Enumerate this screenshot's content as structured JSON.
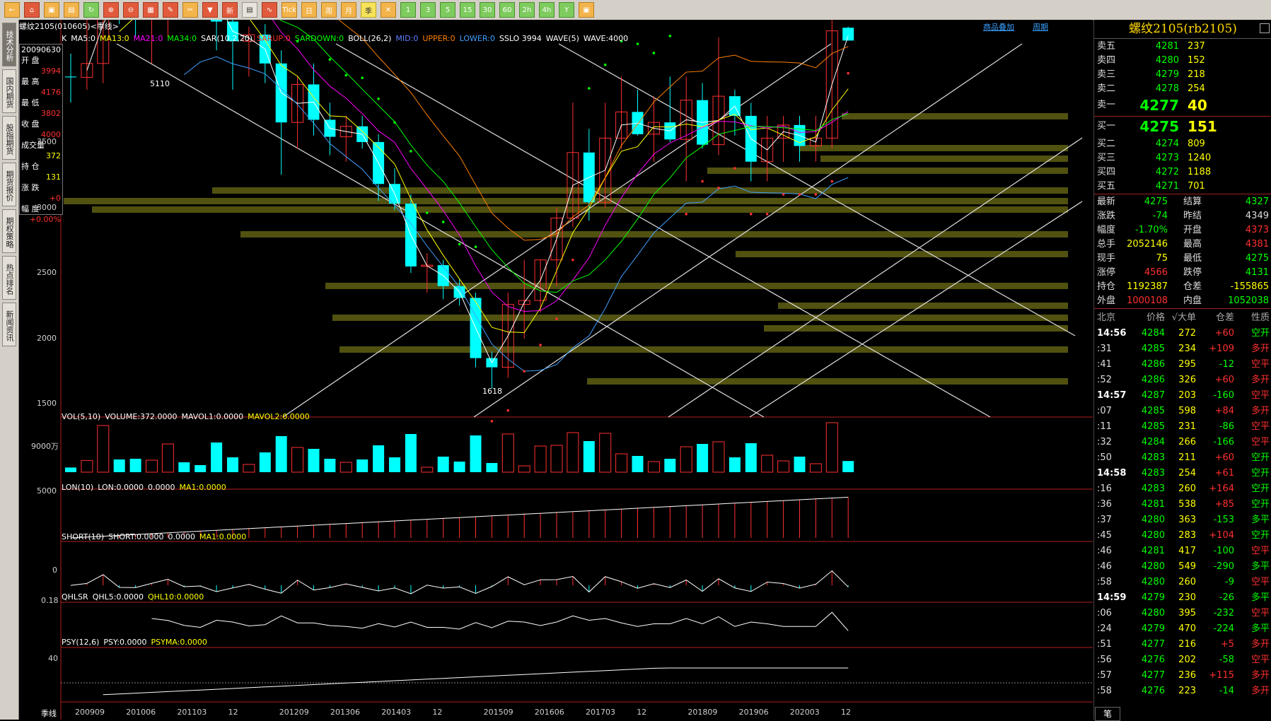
{
  "toolbar": {
    "buttons": [
      "←",
      "⌂",
      "▣",
      "▤",
      "↻",
      "⊕",
      "⊖",
      "▦",
      "✎",
      "✂",
      "▼",
      "新",
      "▤",
      "∿",
      "Tick",
      "日",
      "周",
      "月",
      "季",
      "✕",
      "1",
      "3",
      "5",
      "15",
      "30",
      "60",
      "2h",
      "4h",
      "Y",
      "▣"
    ]
  },
  "left_tabs": [
    "技术分析",
    "国内期货",
    "股指期货",
    "期货报价",
    "期权策略",
    "热点排名",
    "新闻资讯"
  ],
  "subtitle": "螺纹2105(010605)<季线>",
  "links": {
    "overlay": "商品叠加",
    "period": "周期"
  },
  "main_indicators": [
    {
      "t": "K",
      "c": "#ffffff"
    },
    {
      "t": "MA5:0",
      "c": "#ffffff"
    },
    {
      "t": "MA13:0",
      "c": "#ffff00"
    },
    {
      "t": "MA21:0",
      "c": "#ff00ff"
    },
    {
      "t": "MA34:0",
      "c": "#00ff00"
    },
    {
      "t": "SAR(10,2,20)",
      "c": "#ffffff"
    },
    {
      "t": "SARUP:0",
      "c": "#ff3030"
    },
    {
      "t": "SARDOWN:0",
      "c": "#00ff00"
    },
    {
      "t": "BOLL(26,2)",
      "c": "#ffffff"
    },
    {
      "t": "MID:0",
      "c": "#6080ff"
    },
    {
      "t": "UPPER:0",
      "c": "#ff8000"
    },
    {
      "t": "LOWER:0",
      "c": "#40a0ff"
    },
    {
      "t": "SSLO 3994",
      "c": "#ffffff"
    },
    {
      "t": "WAVE(5)",
      "c": "#ffffff"
    },
    {
      "t": "WAVE:4000",
      "c": "#ffffff"
    }
  ],
  "infobox": {
    "date": "20090630",
    "rows": [
      {
        "label": "开 盘",
        "value": "3994",
        "color": "#ff3030"
      },
      {
        "label": "最 高",
        "value": "4176",
        "color": "#ff3030"
      },
      {
        "label": "最 低",
        "value": "3802",
        "color": "#ff3030"
      },
      {
        "label": "收 盘",
        "value": "4000",
        "color": "#ff3030"
      },
      {
        "label": "成交量",
        "value": "372",
        "color": "#ffff00"
      },
      {
        "label": "持 仓",
        "value": "131",
        "color": "#ffff00"
      },
      {
        "label": "涨 跌",
        "value": "+0",
        "color": "#ff3030"
      },
      {
        "label": "幅 度",
        "value": "+0.00%",
        "color": "#ff3030"
      }
    ]
  },
  "price_axis": [
    "3500",
    "3000",
    "2500",
    "2000",
    "1500"
  ],
  "annotations": {
    "high": "5110",
    "low": "1618"
  },
  "vol_panel": {
    "title_parts": [
      {
        "t": "VOL(5,10)",
        "c": "#ffffff"
      },
      {
        "t": "VOLUME:372.0000",
        "c": "#ffffff"
      },
      {
        "t": "MAVOL1:0.0000",
        "c": "#ffffff"
      },
      {
        "t": "MAVOL2:0.0000",
        "c": "#ffff00"
      }
    ],
    "axis": "9000万"
  },
  "lon_panel": {
    "title_parts": [
      {
        "t": "LON(10)",
        "c": "#ffffff"
      },
      {
        "t": "LON:0.0000",
        "c": "#ffffff"
      },
      {
        "t": "0.0000",
        "c": "#ffffff"
      },
      {
        "t": "MA1:0.0000",
        "c": "#ffff00"
      }
    ],
    "axis": "5000"
  },
  "short_panel": {
    "title_parts": [
      {
        "t": "SHORT(10)",
        "c": "#ffffff"
      },
      {
        "t": "SHORT:0.0000",
        "c": "#ffffff"
      },
      {
        "t": "0.0000",
        "c": "#ffffff"
      },
      {
        "t": "MA1:0.0000",
        "c": "#ffff00"
      }
    ],
    "axis": "0"
  },
  "qhlsr_panel": {
    "title_parts": [
      {
        "t": "QHLSR",
        "c": "#ffffff"
      },
      {
        "t": "QHL5:0.0000",
        "c": "#ffffff"
      },
      {
        "t": "QHL10:0.0000",
        "c": "#ffff00"
      }
    ],
    "axis": "0.18"
  },
  "psy_panel": {
    "title_parts": [
      {
        "t": "PSY(12,6)",
        "c": "#ffffff"
      },
      {
        "t": "PSY:0.0000",
        "c": "#ffffff"
      },
      {
        "t": "PSYMA:0.0000",
        "c": "#ffff00"
      }
    ],
    "axis": "40"
  },
  "x_axis": {
    "period": "季线",
    "labels": [
      "200909",
      "201006",
      "201103",
      "12",
      "201209",
      "201306",
      "201403",
      "12",
      "201509",
      "201606",
      "201703",
      "12",
      "201809",
      "201906",
      "202003",
      "12"
    ]
  },
  "quote": {
    "title": "螺纹2105(rb2105)",
    "asks": [
      {
        "name": "卖五",
        "price": "4281",
        "vol": "237"
      },
      {
        "name": "卖四",
        "price": "4280",
        "vol": "152"
      },
      {
        "name": "卖三",
        "price": "4279",
        "vol": "218"
      },
      {
        "name": "卖二",
        "price": "4278",
        "vol": "254"
      },
      {
        "name": "卖一",
        "price": "4277",
        "vol": "40"
      }
    ],
    "bids": [
      {
        "name": "买一",
        "price": "4275",
        "vol": "151"
      },
      {
        "name": "买二",
        "price": "4274",
        "vol": "809"
      },
      {
        "name": "买三",
        "price": "4273",
        "vol": "1240"
      },
      {
        "name": "买四",
        "price": "4272",
        "vol": "1188"
      },
      {
        "name": "买五",
        "price": "4271",
        "vol": "701"
      }
    ],
    "stats": [
      {
        "l1": "最新",
        "v1": "4275",
        "c1": "#00ff00",
        "l2": "结算",
        "v2": "4327",
        "c2": "#00ff00"
      },
      {
        "l1": "涨跌",
        "v1": "-74",
        "c1": "#00ff00",
        "l2": "昨结",
        "v2": "4349",
        "c2": "#dddddd"
      },
      {
        "l1": "幅度",
        "v1": "-1.70%",
        "c1": "#00ff00",
        "l2": "开盘",
        "v2": "4373",
        "c2": "#ff3030"
      },
      {
        "l1": "总手",
        "v1": "2052146",
        "c1": "#ffff00",
        "l2": "最高",
        "v2": "4381",
        "c2": "#ff3030"
      },
      {
        "l1": "现手",
        "v1": "75",
        "c1": "#ffff00",
        "l2": "最低",
        "v2": "4275",
        "c2": "#00ff00"
      },
      {
        "l1": "涨停",
        "v1": "4566",
        "c1": "#ff3030",
        "l2": "跌停",
        "v2": "4131",
        "c2": "#00ff00"
      },
      {
        "l1": "持仓",
        "v1": "1192387",
        "c1": "#ffff00",
        "l2": "仓差",
        "v2": "-155865",
        "c2": "#ffff00"
      },
      {
        "l1": "外盘",
        "v1": "1000108",
        "c1": "#ff3030",
        "l2": "内盘",
        "v2": "1052038",
        "c2": "#00ff00"
      }
    ],
    "tick_header": [
      "北京",
      "价格",
      "√大单",
      "仓差",
      "性质"
    ],
    "ticks": [
      {
        "t": "14:56",
        "b": true,
        "p": "4284",
        "v": "272",
        "c": "+60",
        "cc": "#ff3030",
        "k": "空开",
        "kc": "#00ff00"
      },
      {
        "t": ":31",
        "b": false,
        "p": "4285",
        "v": "234",
        "c": "+109",
        "cc": "#ff3030",
        "k": "多开",
        "kc": "#ff3030"
      },
      {
        "t": ":41",
        "b": false,
        "p": "4286",
        "v": "295",
        "c": "-12",
        "cc": "#00ff00",
        "k": "空平",
        "kc": "#ff3030"
      },
      {
        "t": ":52",
        "b": false,
        "p": "4286",
        "v": "326",
        "c": "+60",
        "cc": "#ff3030",
        "k": "多开",
        "kc": "#ff3030"
      },
      {
        "t": "14:57",
        "b": true,
        "p": "4287",
        "v": "203",
        "c": "-160",
        "cc": "#00ff00",
        "k": "空平",
        "kc": "#ff3030"
      },
      {
        "t": ":07",
        "b": false,
        "p": "4285",
        "v": "598",
        "c": "+84",
        "cc": "#ff3030",
        "k": "多开",
        "kc": "#ff3030"
      },
      {
        "t": ":11",
        "b": false,
        "p": "4285",
        "v": "231",
        "c": "-86",
        "cc": "#00ff00",
        "k": "空平",
        "kc": "#ff3030"
      },
      {
        "t": ":32",
        "b": false,
        "p": "4284",
        "v": "266",
        "c": "-166",
        "cc": "#00ff00",
        "k": "空平",
        "kc": "#ff3030"
      },
      {
        "t": ":50",
        "b": false,
        "p": "4283",
        "v": "211",
        "c": "+60",
        "cc": "#ff3030",
        "k": "空开",
        "kc": "#00ff00"
      },
      {
        "t": "14:58",
        "b": true,
        "p": "4283",
        "v": "254",
        "c": "+61",
        "cc": "#ff3030",
        "k": "空开",
        "kc": "#00ff00"
      },
      {
        "t": ":16",
        "b": false,
        "p": "4283",
        "v": "260",
        "c": "+164",
        "cc": "#ff3030",
        "k": "空开",
        "kc": "#00ff00"
      },
      {
        "t": ":36",
        "b": false,
        "p": "4281",
        "v": "538",
        "c": "+85",
        "cc": "#ff3030",
        "k": "空开",
        "kc": "#00ff00"
      },
      {
        "t": ":37",
        "b": false,
        "p": "4280",
        "v": "363",
        "c": "-153",
        "cc": "#00ff00",
        "k": "多平",
        "kc": "#00ff00"
      },
      {
        "t": ":45",
        "b": false,
        "p": "4280",
        "v": "283",
        "c": "+104",
        "cc": "#ff3030",
        "k": "空开",
        "kc": "#00ff00"
      },
      {
        "t": ":46",
        "b": false,
        "p": "4281",
        "v": "417",
        "c": "-100",
        "cc": "#00ff00",
        "k": "空平",
        "kc": "#ff3030"
      },
      {
        "t": ":46",
        "b": false,
        "p": "4280",
        "v": "549",
        "c": "-290",
        "cc": "#00ff00",
        "k": "多平",
        "kc": "#00ff00"
      },
      {
        "t": ":58",
        "b": false,
        "p": "4280",
        "v": "260",
        "c": "-9",
        "cc": "#00ff00",
        "k": "空平",
        "kc": "#ff3030"
      },
      {
        "t": "14:59",
        "b": true,
        "p": "4279",
        "v": "230",
        "c": "-26",
        "cc": "#00ff00",
        "k": "多平",
        "kc": "#00ff00"
      },
      {
        "t": ":06",
        "b": false,
        "p": "4280",
        "v": "395",
        "c": "-232",
        "cc": "#00ff00",
        "k": "空平",
        "kc": "#ff3030"
      },
      {
        "t": ":24",
        "b": false,
        "p": "4279",
        "v": "470",
        "c": "-224",
        "cc": "#00ff00",
        "k": "多平",
        "kc": "#00ff00"
      },
      {
        "t": ":51",
        "b": false,
        "p": "4277",
        "v": "216",
        "c": "+5",
        "cc": "#ff3030",
        "k": "多开",
        "kc": "#ff3030"
      },
      {
        "t": ":56",
        "b": false,
        "p": "4276",
        "v": "202",
        "c": "-58",
        "cc": "#00ff00",
        "k": "空平",
        "kc": "#ff3030"
      },
      {
        "t": ":57",
        "b": false,
        "p": "4277",
        "v": "236",
        "c": "+115",
        "cc": "#ff3030",
        "k": "多开",
        "kc": "#ff3030"
      },
      {
        "t": ":58",
        "b": false,
        "p": "4276",
        "v": "223",
        "c": "-14",
        "cc": "#00ff00",
        "k": "多开",
        "kc": "#ff3030"
      }
    ],
    "bottom_tab": "笔"
  },
  "chart_data": {
    "type": "candlestick",
    "period": "季线",
    "candles": [
      {
        "o": 4000,
        "h": 4176,
        "l": 3802,
        "c": 3994
      },
      {
        "o": 3994,
        "h": 4500,
        "l": 3900,
        "c": 4100
      },
      {
        "o": 4100,
        "h": 4900,
        "l": 3950,
        "c": 4700
      },
      {
        "o": 4700,
        "h": 4850,
        "l": 4400,
        "c": 4580
      },
      {
        "o": 4580,
        "h": 4700,
        "l": 4300,
        "c": 4450
      },
      {
        "o": 4450,
        "h": 4900,
        "l": 4100,
        "c": 4560
      },
      {
        "o": 4560,
        "h": 4990,
        "l": 4300,
        "c": 4900
      },
      {
        "o": 4900,
        "h": 5110,
        "l": 4700,
        "c": 4820
      },
      {
        "o": 4820,
        "h": 4950,
        "l": 4650,
        "c": 4780
      },
      {
        "o": 4780,
        "h": 4900,
        "l": 4200,
        "c": 4420
      },
      {
        "o": 4420,
        "h": 4500,
        "l": 3900,
        "c": 4270
      },
      {
        "o": 4270,
        "h": 4380,
        "l": 4000,
        "c": 4320
      },
      {
        "o": 4320,
        "h": 4400,
        "l": 3950,
        "c": 4100
      },
      {
        "o": 4100,
        "h": 4200,
        "l": 3250,
        "c": 3650
      },
      {
        "o": 3650,
        "h": 4000,
        "l": 3450,
        "c": 3940
      },
      {
        "o": 3940,
        "h": 4100,
        "l": 3550,
        "c": 3670
      },
      {
        "o": 3670,
        "h": 3800,
        "l": 3400,
        "c": 3540
      },
      {
        "o": 3540,
        "h": 3700,
        "l": 3350,
        "c": 3620
      },
      {
        "o": 3620,
        "h": 3700,
        "l": 3450,
        "c": 3500
      },
      {
        "o": 3500,
        "h": 3560,
        "l": 3050,
        "c": 3180
      },
      {
        "o": 3180,
        "h": 3300,
        "l": 2980,
        "c": 3030
      },
      {
        "o": 3030,
        "h": 3100,
        "l": 2500,
        "c": 2550
      },
      {
        "o": 2550,
        "h": 2650,
        "l": 2350,
        "c": 2560
      },
      {
        "o": 2560,
        "h": 2600,
        "l": 2300,
        "c": 2400
      },
      {
        "o": 2400,
        "h": 2450,
        "l": 2250,
        "c": 2310
      },
      {
        "o": 2310,
        "h": 2350,
        "l": 1780,
        "c": 1850
      },
      {
        "o": 1850,
        "h": 1900,
        "l": 1618,
        "c": 1780
      },
      {
        "o": 1780,
        "h": 2350,
        "l": 1700,
        "c": 2260
      },
      {
        "o": 2260,
        "h": 2600,
        "l": 2000,
        "c": 2290
      },
      {
        "o": 2290,
        "h": 2600,
        "l": 2200,
        "c": 2600
      },
      {
        "o": 2600,
        "h": 3000,
        "l": 2400,
        "c": 2920
      },
      {
        "o": 2920,
        "h": 3800,
        "l": 2850,
        "c": 3420
      },
      {
        "o": 3420,
        "h": 3600,
        "l": 2900,
        "c": 3040
      },
      {
        "o": 3040,
        "h": 3800,
        "l": 3000,
        "c": 3530
      },
      {
        "o": 3530,
        "h": 4000,
        "l": 3450,
        "c": 3730
      },
      {
        "o": 3730,
        "h": 3900,
        "l": 3550,
        "c": 3560
      },
      {
        "o": 3560,
        "h": 3850,
        "l": 3350,
        "c": 3650
      },
      {
        "o": 3650,
        "h": 4000,
        "l": 3500,
        "c": 3520
      },
      {
        "o": 3520,
        "h": 4000,
        "l": 3200,
        "c": 3820
      },
      {
        "o": 3820,
        "h": 3950,
        "l": 3450,
        "c": 3480
      },
      {
        "o": 3480,
        "h": 4300,
        "l": 3400,
        "c": 3850
      },
      {
        "o": 3850,
        "h": 3900,
        "l": 3550,
        "c": 3700
      },
      {
        "o": 3700,
        "h": 3800,
        "l": 3200,
        "c": 3350
      },
      {
        "o": 3350,
        "h": 3700,
        "l": 3200,
        "c": 3530
      },
      {
        "o": 3530,
        "h": 3700,
        "l": 3350,
        "c": 3630
      },
      {
        "o": 3630,
        "h": 3700,
        "l": 3350,
        "c": 3470
      },
      {
        "o": 3470,
        "h": 3700,
        "l": 3350,
        "c": 3530
      },
      {
        "o": 3530,
        "h": 4600,
        "l": 3450,
        "c": 4349
      },
      {
        "o": 4373,
        "h": 4381,
        "l": 4275,
        "c": 4275
      }
    ]
  }
}
